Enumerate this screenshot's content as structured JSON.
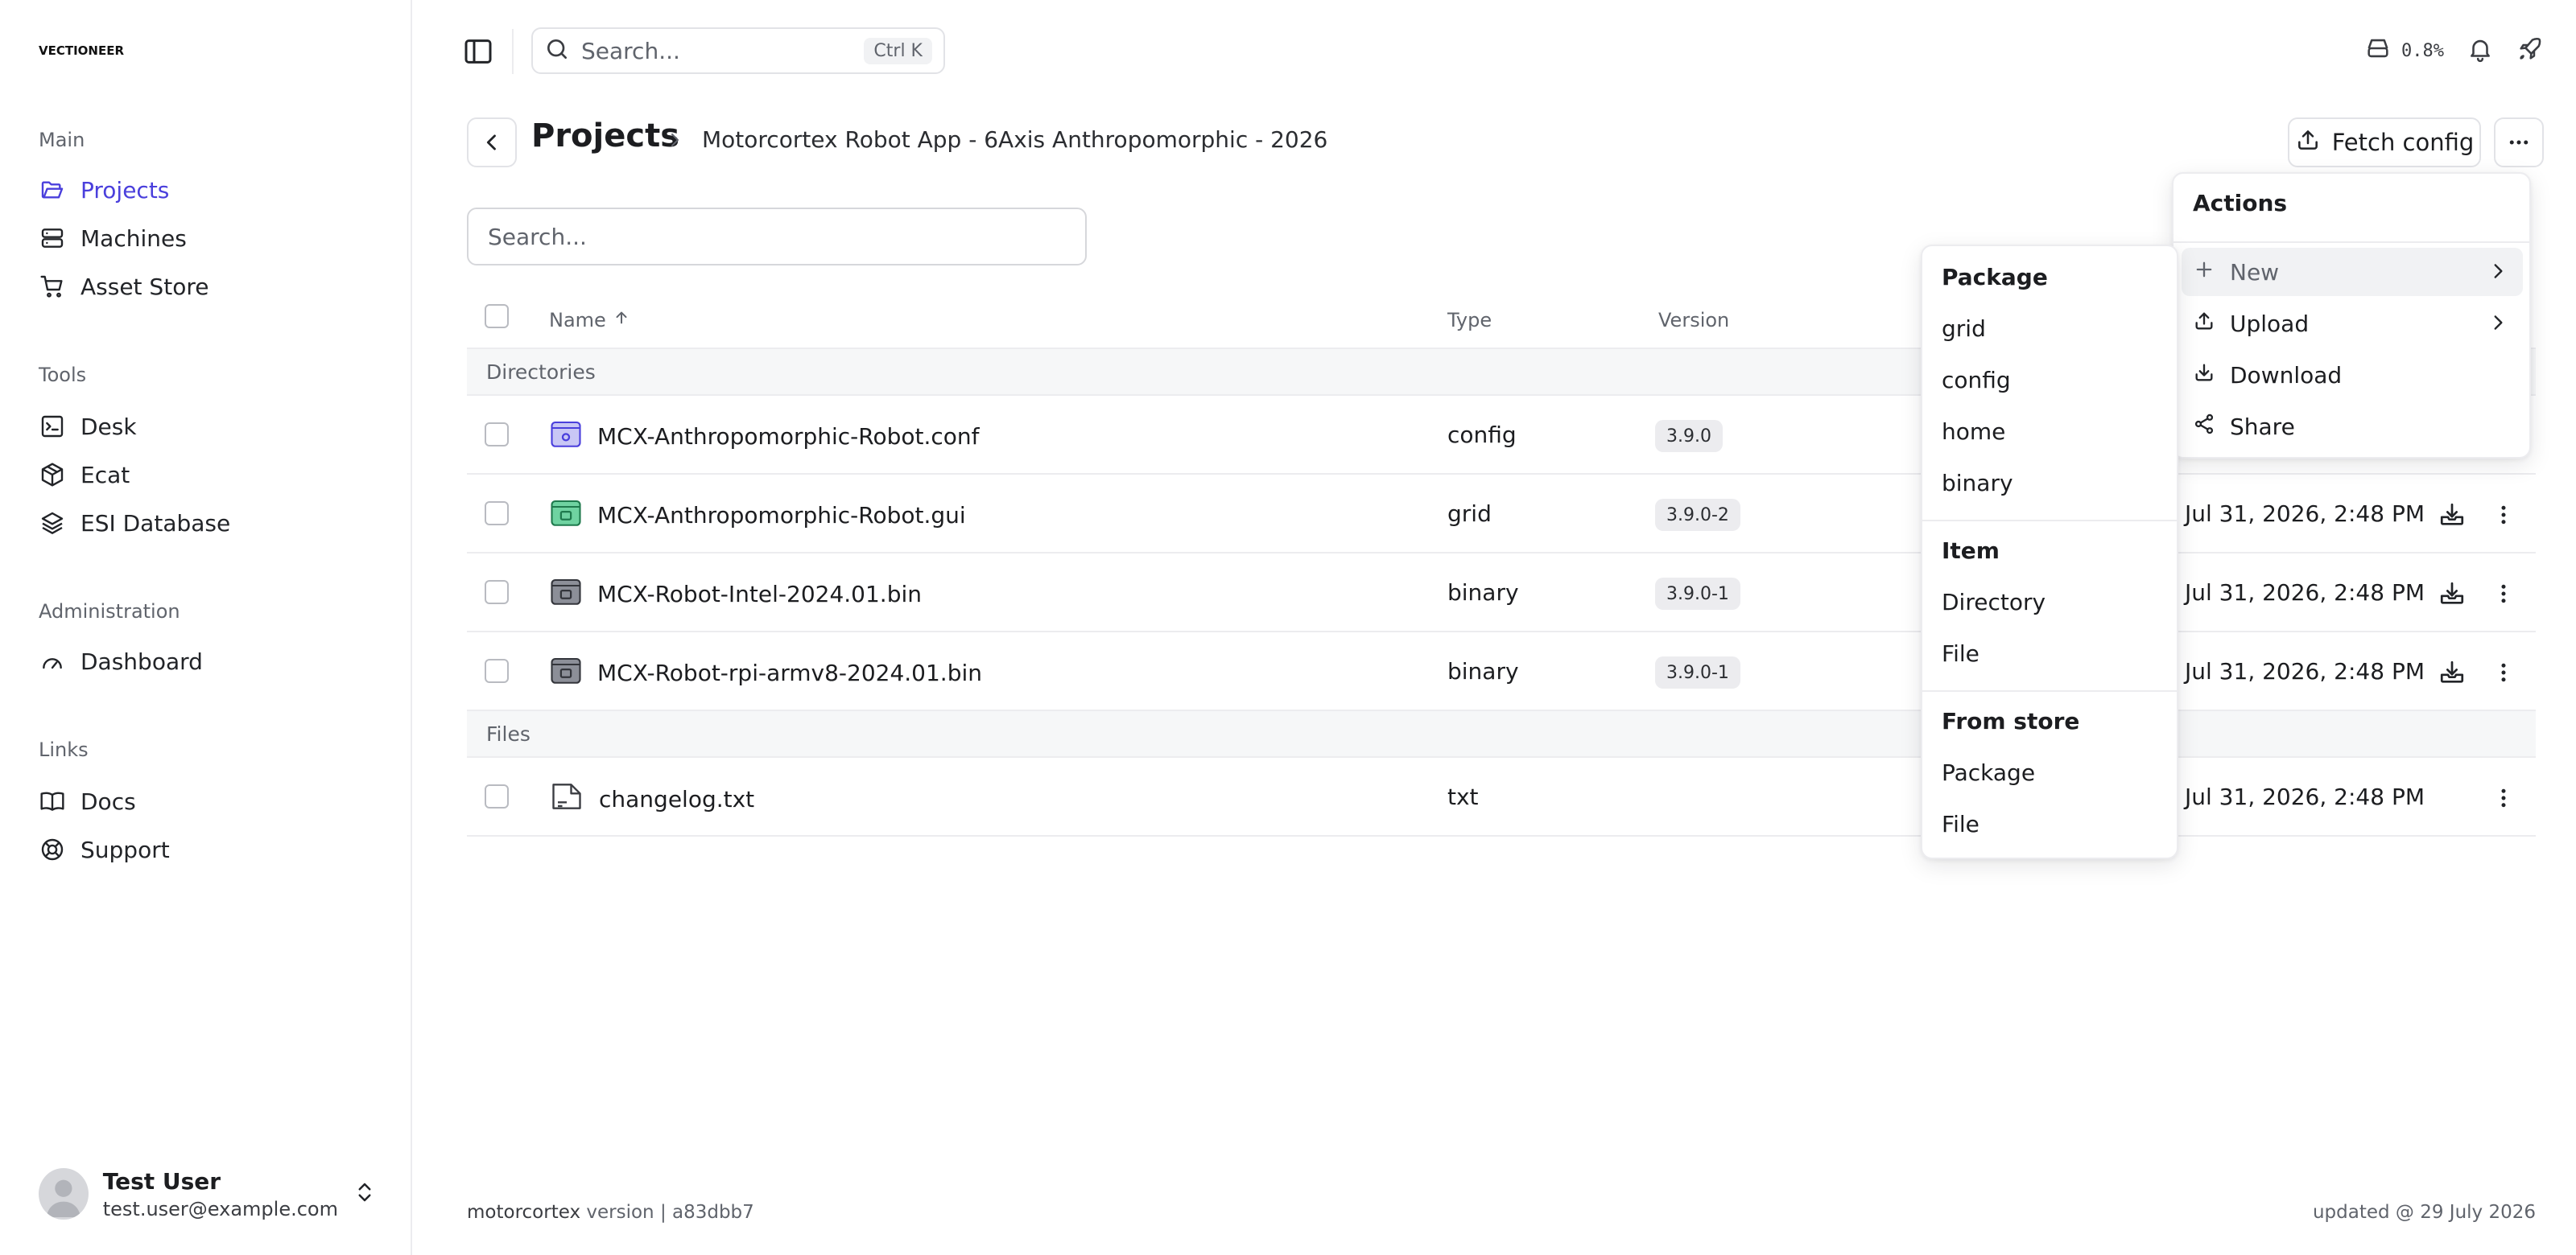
{
  "app": {
    "logo_text": "VECTIONEER"
  },
  "sidebar": {
    "sections": [
      {
        "title": "Main",
        "items": [
          {
            "label": "Projects",
            "icon": "folder-open-icon",
            "active": true
          },
          {
            "label": "Machines",
            "icon": "server-icon"
          },
          {
            "label": "Asset Store",
            "icon": "cart-icon"
          }
        ]
      },
      {
        "title": "Tools",
        "items": [
          {
            "label": "Desk",
            "icon": "terminal-icon"
          },
          {
            "label": "Ecat",
            "icon": "box-icon"
          },
          {
            "label": "ESI Database",
            "icon": "layers-icon"
          }
        ]
      },
      {
        "title": "Administration",
        "items": [
          {
            "label": "Dashboard",
            "icon": "gauge-icon"
          }
        ]
      },
      {
        "title": "Links",
        "items": [
          {
            "label": "Docs",
            "icon": "book-icon"
          },
          {
            "label": "Support",
            "icon": "lifebuoy-icon"
          }
        ]
      }
    ],
    "user": {
      "name": "Test User",
      "email": "test.user@example.com"
    }
  },
  "topbar": {
    "search_placeholder": "Search...",
    "shortcut": "Ctrl K",
    "usage": "0.8%"
  },
  "header": {
    "title": "Projects",
    "breadcrumb": "Motorcortex Robot App - 6Axis Anthropomorphic - 2026",
    "fetch_label": "Fetch config"
  },
  "list": {
    "search_placeholder": "Search...",
    "columns": {
      "name": "Name",
      "type": "Type",
      "version": "Version"
    },
    "groups": {
      "directories": "Directories",
      "files": "Files"
    },
    "rows": [
      {
        "name": "MCX-Anthropomorphic-Robot.conf",
        "type": "config",
        "version": "3.9.0",
        "date": "",
        "icon_color": "#c9c7f5",
        "icon_stroke": "#4a3fdc"
      },
      {
        "name": "MCX-Anthropomorphic-Robot.gui",
        "type": "grid",
        "version": "3.9.0-2",
        "date": "Jul 31, 2026, 2:48 PM",
        "icon_color": "#6fd3a1",
        "icon_stroke": "#1f7a4d"
      },
      {
        "name": "MCX-Robot-Intel-2024.01.bin",
        "type": "binary",
        "version": "3.9.0-1",
        "date": "Jul 31, 2026, 2:48 PM",
        "icon_color": "#8c8f98",
        "icon_stroke": "#33353b"
      },
      {
        "name": "MCX-Robot-rpi-armv8-2024.01.bin",
        "type": "binary",
        "version": "3.9.0-1",
        "date": "Jul 31, 2026, 2:48 PM",
        "icon_color": "#8c8f98",
        "icon_stroke": "#33353b"
      }
    ],
    "files": [
      {
        "name": "changelog.txt",
        "type": "txt",
        "date": "Jul 31, 2026, 2:48 PM"
      }
    ]
  },
  "actions_menu": {
    "title": "Actions",
    "items": [
      {
        "label": "New",
        "icon": "plus-icon",
        "submenu": true
      },
      {
        "label": "Upload",
        "icon": "upload-icon",
        "submenu": true
      },
      {
        "label": "Download",
        "icon": "download-icon"
      },
      {
        "label": "Share",
        "icon": "share-icon"
      }
    ]
  },
  "new_submenu": {
    "package_head": "Package",
    "package_items": [
      "grid",
      "config",
      "home",
      "binary"
    ],
    "item_head": "Item",
    "item_items": [
      "Directory",
      "File"
    ],
    "store_head": "From store",
    "store_items": [
      "Package",
      "File"
    ]
  },
  "footer": {
    "brand": "motorcortex",
    "version_text": " version | a83dbb7",
    "updated": "updated @ 29 July 2026"
  },
  "colors": {
    "accent": "#4a3fdc",
    "border": "#ececef",
    "muted": "#60646c"
  }
}
